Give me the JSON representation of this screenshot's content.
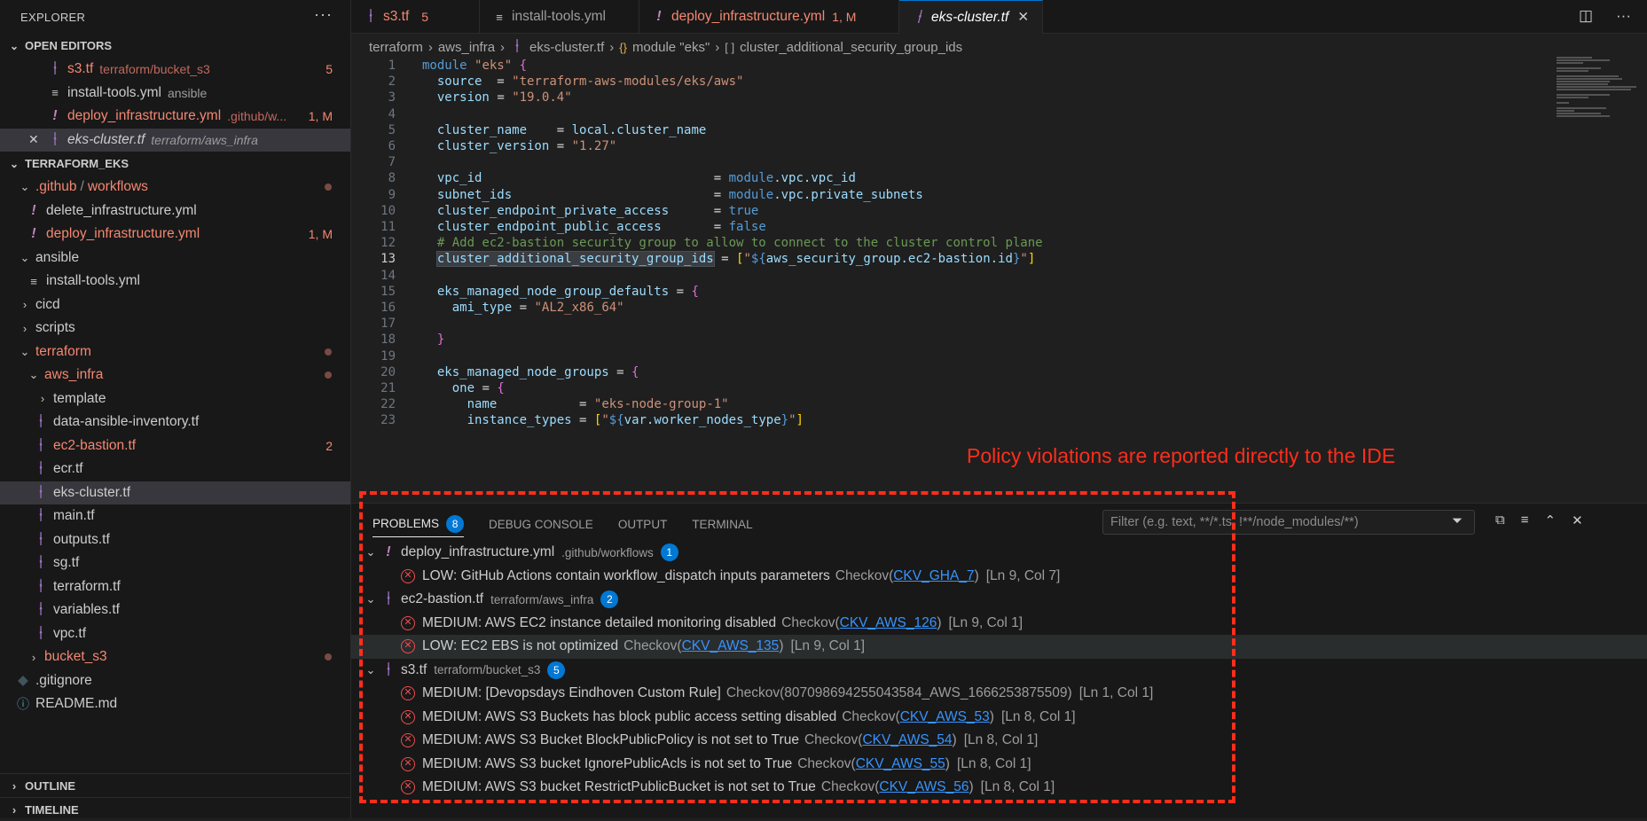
{
  "explorer": {
    "title": "EXPLORER",
    "more_label": "···",
    "open_editors_title": "OPEN EDITORS",
    "open_editors": [
      {
        "name": "s3.tf",
        "path": "terraform/bucket_s3",
        "badge": "5",
        "icon": "terraform-icon"
      },
      {
        "name": "install-tools.yml",
        "path": "ansible",
        "badge": "",
        "icon": "yaml-icon"
      },
      {
        "name": "deploy_infrastructure.yml",
        "path": ".github/w...",
        "badge": "1, M",
        "icon": "exclamation-icon"
      },
      {
        "name": "eks-cluster.tf",
        "path": "terraform/aws_infra",
        "badge": "",
        "icon": "terraform-icon"
      }
    ],
    "project_title": "TERRAFORM_EKS",
    "tree": {
      "github_folder": ".github",
      "workflows_folder": "workflows",
      "delete_infra": "delete_infrastructure.yml",
      "deploy_infra": "deploy_infrastructure.yml",
      "deploy_infra_badge": "1, M",
      "ansible": "ansible",
      "install_tools": "install-tools.yml",
      "cicd": "cicd",
      "scripts": "scripts",
      "terraform": "terraform",
      "aws_infra": "aws_infra",
      "template": "template",
      "data_ansible": "data-ansible-inventory.tf",
      "ec2_bastion": "ec2-bastion.tf",
      "ec2_bastion_badge": "2",
      "ecr": "ecr.tf",
      "eks_cluster": "eks-cluster.tf",
      "main": "main.tf",
      "outputs": "outputs.tf",
      "sg": "sg.tf",
      "terraform_tf": "terraform.tf",
      "variables": "variables.tf",
      "vpc": "vpc.tf",
      "bucket_s3": "bucket_s3",
      "gitignore": ".gitignore",
      "readme": "README.md"
    },
    "outline_title": "OUTLINE",
    "timeline_title": "TIMELINE"
  },
  "tabs": [
    {
      "label": "s3.tf",
      "badge": "5",
      "icon": "terraform-icon"
    },
    {
      "label": "install-tools.yml",
      "badge": "",
      "icon": "yaml-icon"
    },
    {
      "label": "deploy_infrastructure.yml",
      "badge": "1, M",
      "icon": "exclamation-icon"
    },
    {
      "label": "eks-cluster.tf",
      "badge": "",
      "icon": "terraform-icon",
      "close": "✕"
    }
  ],
  "breadcrumb": {
    "p1": "terraform",
    "p2": "aws_infra",
    "p3": "eks-cluster.tf",
    "p4": "module \"eks\"",
    "p5": "cluster_additional_security_group_ids",
    "p5_icon": "[ ]"
  },
  "editor": {
    "current_line": 13,
    "lines": [
      "module \"eks\" {",
      "  source  = \"terraform-aws-modules/eks/aws\"",
      "  version = \"19.0.4\"",
      "",
      "  cluster_name    = local.cluster_name",
      "  cluster_version = \"1.27\"",
      "",
      "  vpc_id                               = module.vpc.vpc_id",
      "  subnet_ids                           = module.vpc.private_subnets",
      "  cluster_endpoint_private_access      = true",
      "  cluster_endpoint_public_access       = false",
      "  # Add ec2-bastion security group to allow to connect to the cluster control plane",
      "  cluster_additional_security_group_ids = [\"${aws_security_group.ec2-bastion.id}\"]",
      "",
      "  eks_managed_node_group_defaults = {",
      "    ami_type = \"AL2_x86_64\"",
      "",
      "  }",
      "",
      "  eks_managed_node_groups = {",
      "    one = {",
      "      name           = \"eks-node-group-1\"",
      "      instance_types = [\"${var.worker_nodes_type}\"]"
    ]
  },
  "annotation": "Policy violations are reported directly to the IDE",
  "panel": {
    "tabs": [
      "PROBLEMS",
      "DEBUG CONSOLE",
      "OUTPUT",
      "TERMINAL"
    ],
    "problems_count": "8",
    "filter_placeholder": "Filter (e.g. text, **/*.ts, !**/node_modules/**)",
    "groups": [
      {
        "file": "deploy_infrastructure.yml",
        "path": ".github/workflows",
        "count": "1",
        "icon": "exclamation-icon",
        "items": [
          {
            "msg": "LOW: GitHub Actions contain workflow_dispatch inputs parameters",
            "source": "Checkov(",
            "code": "CKV_GHA_7",
            "close": ")",
            "pos": "[Ln 9, Col 7]"
          }
        ]
      },
      {
        "file": "ec2-bastion.tf",
        "path": "terraform/aws_infra",
        "count": "2",
        "icon": "terraform-icon",
        "items": [
          {
            "msg": "MEDIUM: AWS EC2 instance detailed monitoring disabled",
            "source": "Checkov(",
            "code": "CKV_AWS_126",
            "close": ")",
            "pos": "[Ln 9, Col 1]"
          },
          {
            "msg": "LOW: EC2 EBS is not optimized",
            "source": "Checkov(",
            "code": "CKV_AWS_135",
            "close": ")",
            "pos": "[Ln 9, Col 1]"
          }
        ]
      },
      {
        "file": "s3.tf",
        "path": "terraform/bucket_s3",
        "count": "5",
        "icon": "terraform-icon",
        "items": [
          {
            "msg": "MEDIUM: [Devopsdays Eindhoven Custom Rule]",
            "source": "Checkov(807098694255043584_AWS_1666253875509)",
            "code": "",
            "close": "",
            "pos": "[Ln 1, Col 1]"
          },
          {
            "msg": "MEDIUM: AWS S3 Buckets has block public access setting disabled",
            "source": "Checkov(",
            "code": "CKV_AWS_53",
            "close": ")",
            "pos": "[Ln 8, Col 1]"
          },
          {
            "msg": "MEDIUM: AWS S3 Bucket BlockPublicPolicy is not set to True",
            "source": "Checkov(",
            "code": "CKV_AWS_54",
            "close": ")",
            "pos": "[Ln 8, Col 1]"
          },
          {
            "msg": "MEDIUM: AWS S3 bucket IgnorePublicAcls is not set to True",
            "source": "Checkov(",
            "code": "CKV_AWS_55",
            "close": ")",
            "pos": "[Ln 8, Col 1]"
          },
          {
            "msg": "MEDIUM: AWS S3 bucket RestrictPublicBucket is not set to True",
            "source": "Checkov(",
            "code": "CKV_AWS_56",
            "close": ")",
            "pos": "[Ln 8, Col 1]"
          }
        ]
      }
    ]
  },
  "colors": {
    "accent": "#0078d4",
    "error": "#f14c4c",
    "modified": "#f48771",
    "annotation": "#ff2d1a"
  }
}
